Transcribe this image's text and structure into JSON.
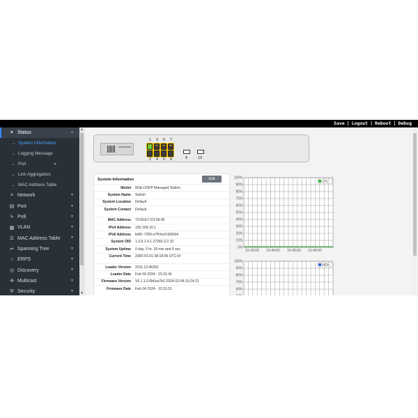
{
  "topbar": {
    "save": "Save",
    "logout": "Logout",
    "reboot": "Reboot",
    "debug": "Debug"
  },
  "sidebar": {
    "items": [
      {
        "label": "Status",
        "icon": "heart-pulse-icon",
        "glyph": "♥",
        "active": true
      },
      {
        "label": "Network",
        "icon": "network-icon",
        "glyph": "⌗"
      },
      {
        "label": "Port",
        "icon": "port-icon",
        "glyph": "▤"
      },
      {
        "label": "PoE",
        "icon": "plug-icon",
        "glyph": "ϟ"
      },
      {
        "label": "VLAN",
        "icon": "vlan-icon",
        "glyph": "▦"
      },
      {
        "label": "MAC Address Table",
        "icon": "table-icon",
        "glyph": "☰"
      },
      {
        "label": "Spanning Tree",
        "icon": "tree-icon",
        "glyph": "⇌"
      },
      {
        "label": "ERPS",
        "icon": "ring-icon",
        "glyph": "○"
      },
      {
        "label": "Discovery",
        "icon": "discovery-icon",
        "glyph": "◎"
      },
      {
        "label": "Multicast",
        "icon": "multicast-icon",
        "glyph": "✣"
      },
      {
        "label": "Security",
        "icon": "shield-icon",
        "glyph": "⛨"
      }
    ],
    "submenu": [
      {
        "label": "System Information",
        "current": true
      },
      {
        "label": "Logging Message"
      },
      {
        "label": "Port",
        "has_children": true
      },
      {
        "label": "Link Aggregation"
      },
      {
        "label": "MAC Address Table"
      }
    ]
  },
  "device": {
    "ports_top": [
      "1",
      "3",
      "5",
      "7"
    ],
    "ports_bottom": [
      "2",
      "4",
      "6",
      "8"
    ],
    "sfp_ports": [
      "9",
      "10"
    ],
    "port_status": {
      "1": "up"
    }
  },
  "system_info": {
    "title": "System Information",
    "edit_label": "Edit",
    "group1": [
      {
        "k": "Model",
        "v": "8GE+2SFP Managed Switch"
      },
      {
        "k": "System Name",
        "v": "Switch"
      },
      {
        "k": "System Location",
        "v": "Default"
      },
      {
        "k": "System Contact",
        "v": "Default"
      }
    ],
    "group2": [
      {
        "k": "MAC Address",
        "v": "70:50:E7:C0:06:06"
      },
      {
        "k": "IPv4 Address",
        "v": "192.168.10.1"
      },
      {
        "k": "IPv6 Address",
        "v": "fe80::7250:e7ff:fec0:606/64"
      },
      {
        "k": "System OID",
        "v": "1.3.6.1.4.1.27282.3.2.10"
      },
      {
        "k": "System Uptime",
        "v": "0 day, 0 hr, 18 min and 6 sec"
      },
      {
        "k": "Current Time",
        "v": "2000-01-01 08:18:06 UTC+8"
      }
    ],
    "group3": [
      {
        "k": "Loader Version",
        "v": "2011.12.46351"
      },
      {
        "k": "Loader Date",
        "v": "Feb 04 2024 - 15:31:41"
      },
      {
        "k": "Firmware Version",
        "v": "V6.1.1.0.6b0ca7b3 2024-02-04-15:24:21"
      },
      {
        "k": "Firmware Date",
        "v": "Feb 04 2024 - 15:31:51"
      }
    ]
  },
  "colors": {
    "sidebar_bg": "#2a3038",
    "accent": "#2f8cff",
    "cpu_line": "#22aa22",
    "mem_line": "#2255dd"
  },
  "chart_data": [
    {
      "type": "line",
      "legend": "CPU",
      "legend_placement": "top-right",
      "y_ticks": [
        "0%",
        "10%",
        "20%",
        "30%",
        "40%",
        "50%",
        "60%",
        "70%",
        "80%",
        "90%",
        "100%"
      ],
      "x_ticks": [
        "16:43:00",
        "16:44:00",
        "16:45:00",
        "16:46:00"
      ],
      "ylim": [
        0,
        100
      ],
      "grid": true,
      "series": [
        {
          "name": "CPU",
          "values": [
            1,
            1,
            1,
            1,
            1,
            1,
            1,
            1,
            1,
            1,
            1,
            1,
            1,
            1,
            1,
            1,
            1,
            1,
            1,
            1
          ]
        }
      ]
    },
    {
      "type": "line",
      "legend": "MEM",
      "legend_placement": "top-right",
      "y_ticks": [
        "50%",
        "60%",
        "70%",
        "80%",
        "90%",
        "100%"
      ],
      "ylim": [
        0,
        100
      ],
      "grid": true,
      "series": [
        {
          "name": "MEM",
          "values": []
        }
      ]
    }
  ]
}
